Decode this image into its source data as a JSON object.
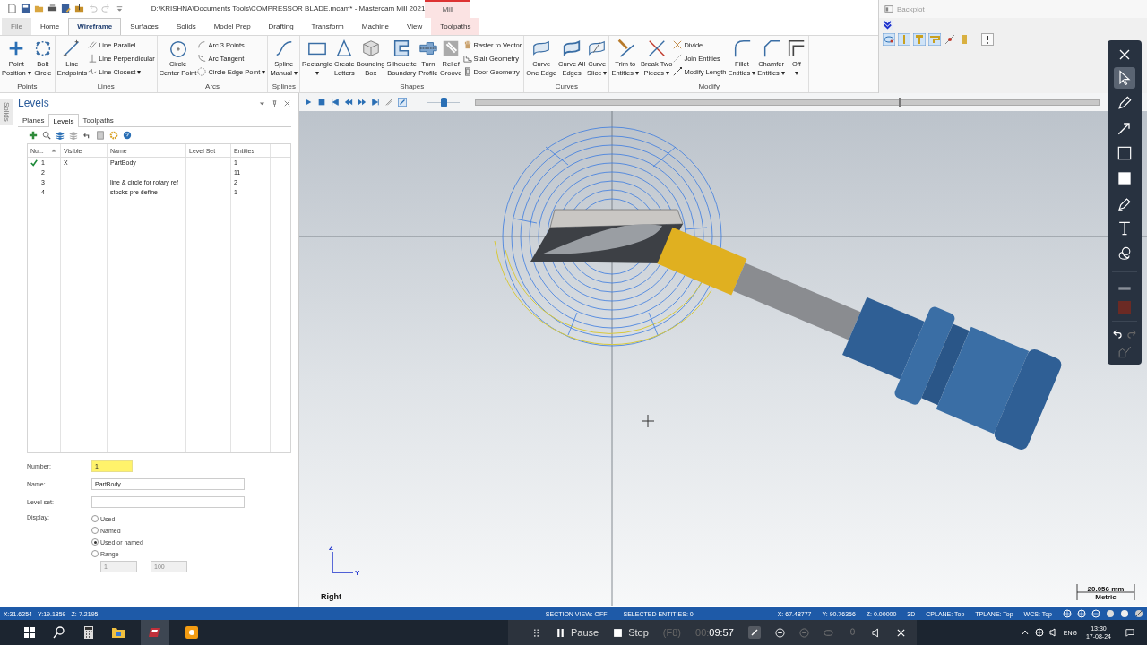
{
  "title_bar": {
    "title": "D:\\KRISHNA\\Documents Tools\\COMPRESSOR BLADE.mcam* - Mastercam Mill 2021",
    "context_tab": "Mill"
  },
  "tabs": [
    {
      "label": "File",
      "kind": "file",
      "selected": false
    },
    {
      "label": "Home",
      "kind": "tab",
      "selected": false
    },
    {
      "label": "Wireframe",
      "kind": "tab",
      "selected": true
    },
    {
      "label": "Surfaces",
      "kind": "tab",
      "selected": false
    },
    {
      "label": "Solids",
      "kind": "tab",
      "selected": false
    },
    {
      "label": "Model Prep",
      "kind": "tab",
      "selected": false
    },
    {
      "label": "Drafting",
      "kind": "tab",
      "selected": false
    },
    {
      "label": "Transform",
      "kind": "tab",
      "selected": false
    },
    {
      "label": "Machine",
      "kind": "tab",
      "selected": false
    },
    {
      "label": "View",
      "kind": "tab",
      "selected": false
    },
    {
      "label": "Toolpaths",
      "kind": "context",
      "selected": false
    }
  ],
  "ribbon": {
    "groups": [
      {
        "name": "Points",
        "items": [
          {
            "kind": "large",
            "lines": [
              "Point",
              "Position ▾"
            ]
          },
          {
            "kind": "large",
            "lines": [
              "Bolt",
              "Circle"
            ]
          }
        ]
      },
      {
        "name": "Lines",
        "items": [
          {
            "kind": "large",
            "lines": [
              "Line",
              "Endpoints"
            ]
          },
          {
            "kind": "small",
            "label": "Line Parallel"
          },
          {
            "kind": "small",
            "label": "Line Perpendicular"
          },
          {
            "kind": "small",
            "label": "Line Closest ▾"
          }
        ]
      },
      {
        "name": "Arcs",
        "items": [
          {
            "kind": "large",
            "lines": [
              "Circle",
              "Center Point"
            ]
          },
          {
            "kind": "small",
            "label": "Arc 3 Points"
          },
          {
            "kind": "small",
            "label": "Arc Tangent"
          },
          {
            "kind": "small",
            "label": "Circle Edge Point ▾"
          }
        ]
      },
      {
        "name": "Splines",
        "items": [
          {
            "kind": "large",
            "lines": [
              "Spline",
              "Manual ▾"
            ]
          }
        ]
      },
      {
        "name": "Shapes",
        "items": [
          {
            "kind": "large",
            "lines": [
              "Rectangle",
              "▾"
            ]
          },
          {
            "kind": "large",
            "lines": [
              "Create",
              "Letters"
            ]
          },
          {
            "kind": "large",
            "lines": [
              "Bounding",
              "Box"
            ]
          },
          {
            "kind": "large",
            "lines": [
              "Silhouette",
              "Boundary"
            ]
          },
          {
            "kind": "large",
            "lines": [
              "Turn",
              "Profile"
            ]
          },
          {
            "kind": "large",
            "lines": [
              "Relief",
              "Groove"
            ]
          },
          {
            "kind": "small",
            "label": "Raster to Vector"
          },
          {
            "kind": "small",
            "label": "Stair Geometry"
          },
          {
            "kind": "small",
            "label": "Door Geometry"
          }
        ]
      },
      {
        "name": "Curves",
        "items": [
          {
            "kind": "large",
            "lines": [
              "Curve",
              "One Edge"
            ]
          },
          {
            "kind": "large",
            "lines": [
              "Curve All",
              "Edges"
            ]
          },
          {
            "kind": "large",
            "lines": [
              "Curve",
              "Slice ▾"
            ]
          }
        ]
      },
      {
        "name": "Modify",
        "items": [
          {
            "kind": "large",
            "lines": [
              "Trim to",
              "Entities ▾"
            ]
          },
          {
            "kind": "large",
            "lines": [
              "Break Two",
              "Pieces ▾"
            ]
          },
          {
            "kind": "small",
            "label": "Divide"
          },
          {
            "kind": "small",
            "label": "Join Entities"
          },
          {
            "kind": "small",
            "label": "Modify Length"
          },
          {
            "kind": "large",
            "lines": [
              "Fillet",
              "Entities ▾"
            ]
          },
          {
            "kind": "large",
            "lines": [
              "Chamfer",
              "Entities ▾"
            ]
          },
          {
            "kind": "large",
            "lines": [
              "Off",
              "▾"
            ]
          }
        ]
      }
    ]
  },
  "backplot": {
    "title": "Backplot"
  },
  "levels_panel": {
    "side_tab": "Solids",
    "title": "Levels",
    "tabs": [
      {
        "label": "Planes",
        "selected": false
      },
      {
        "label": "Levels",
        "selected": true
      },
      {
        "label": "Toolpaths",
        "selected": false
      }
    ],
    "columns": [
      "Nu...",
      "Visible",
      "Name",
      "Level Set",
      "Entities"
    ],
    "rows": [
      {
        "number": "1",
        "active": true,
        "visible": "X",
        "name": "PartBody",
        "entities": "1"
      },
      {
        "number": "2",
        "active": false,
        "entities": "11"
      },
      {
        "number": "3",
        "active": false,
        "name": "line & circle for rotary ref",
        "entities": "2"
      },
      {
        "number": "4",
        "active": false,
        "name": "stocks pre define",
        "entities": "1"
      }
    ],
    "form": {
      "number_label": "Number:",
      "number": "1",
      "name_label": "Name:",
      "name": "PartBody",
      "level_set_label": "Level set:",
      "display_label": "Display:",
      "options": [
        {
          "label": "Used",
          "selected": false
        },
        {
          "label": "Named",
          "selected": false
        },
        {
          "label": "Used or named",
          "selected": true
        },
        {
          "label": "Range",
          "selected": false
        }
      ],
      "range_from": "1",
      "range_to": "100"
    }
  },
  "viewport": {
    "speed": {
      "level": 0.5
    },
    "progress": {
      "level": 0.68
    },
    "axis_z": "Z",
    "axis_y": "Y",
    "view_name": "Right",
    "scale": "20.056 mm",
    "scale_unit": "Metric"
  },
  "annotation_toolbar": {
    "tools": [
      {
        "selected": true
      },
      {
        "selected": false
      },
      {
        "selected": false
      },
      {
        "selected": false
      },
      {
        "selected": false
      },
      {
        "selected": false
      },
      {
        "selected": false
      },
      {
        "selected": false
      }
    ],
    "color": "#6b2a24"
  },
  "status_bar": {
    "cursor": [
      "X:31.6254",
      "Y:19.1859",
      "Z:-7.2195"
    ],
    "view_info": [
      "SECTION VIEW: OFF",
      "SELECTED ENTITIES: 0"
    ],
    "coords": [
      "X: 67.48777",
      "Y: 90.76356",
      "Z: 0.00000",
      "3D",
      "CPLANE: Top",
      "TPLANE: Top",
      "WCS: Top"
    ]
  },
  "recorder": {
    "pause": "Pause",
    "stop": "Stop",
    "stop_key": "(F8)",
    "elapsed_hours": "00:",
    "elapsed": "09:57"
  },
  "tray": {
    "language": "ENG",
    "time": "13:30",
    "date": "17-08-24"
  }
}
